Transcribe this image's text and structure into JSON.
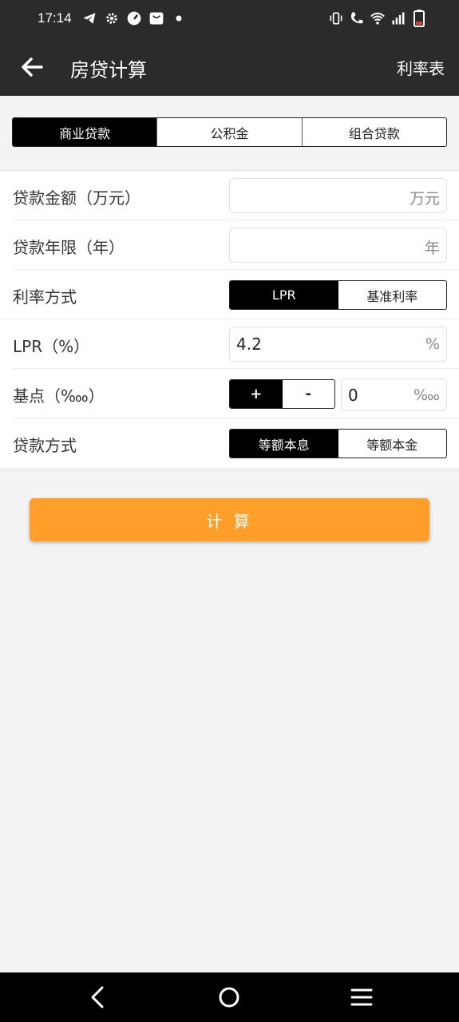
{
  "status_bar": {
    "time": "17:14",
    "left_icons": [
      "telegram-icon",
      "settings-icon",
      "speedometer-icon",
      "shopping-bag-icon",
      "dot-icon"
    ],
    "right_icons": [
      "vibrate-icon",
      "wifi-call-icon",
      "wifi-icon",
      "signal-icon",
      "battery-low-icon"
    ]
  },
  "toolbar": {
    "title": "房贷计算",
    "action": "利率表"
  },
  "tabs": [
    {
      "label": "商业贷款",
      "active": true
    },
    {
      "label": "公积金",
      "active": false
    },
    {
      "label": "组合贷款",
      "active": false
    }
  ],
  "form": {
    "amount": {
      "label": "贷款金额（万元）",
      "value": "",
      "unit": "万元"
    },
    "years": {
      "label": "贷款年限（年）",
      "value": "",
      "unit": "年"
    },
    "rate_mode": {
      "label": "利率方式",
      "options": [
        "LPR",
        "基准利率"
      ],
      "selected": "LPR"
    },
    "lpr": {
      "label": "LPR（%）",
      "value": "4.2",
      "unit": "%"
    },
    "basis": {
      "label": "基点（‱）",
      "plus": "+",
      "minus": "-",
      "value": "0",
      "unit": "‱"
    },
    "repay_mode": {
      "label": "贷款方式",
      "options": [
        "等额本息",
        "等额本金"
      ],
      "selected": "等额本息"
    }
  },
  "calculate_label": "计 算",
  "colors": {
    "header_bg": "#2b2b2b",
    "accent": "#ff9f2a",
    "segment_active": "#000000",
    "page_bg": "#f3f3f3"
  },
  "nav_bar": [
    "back-icon",
    "home-icon",
    "recents-icon"
  ]
}
